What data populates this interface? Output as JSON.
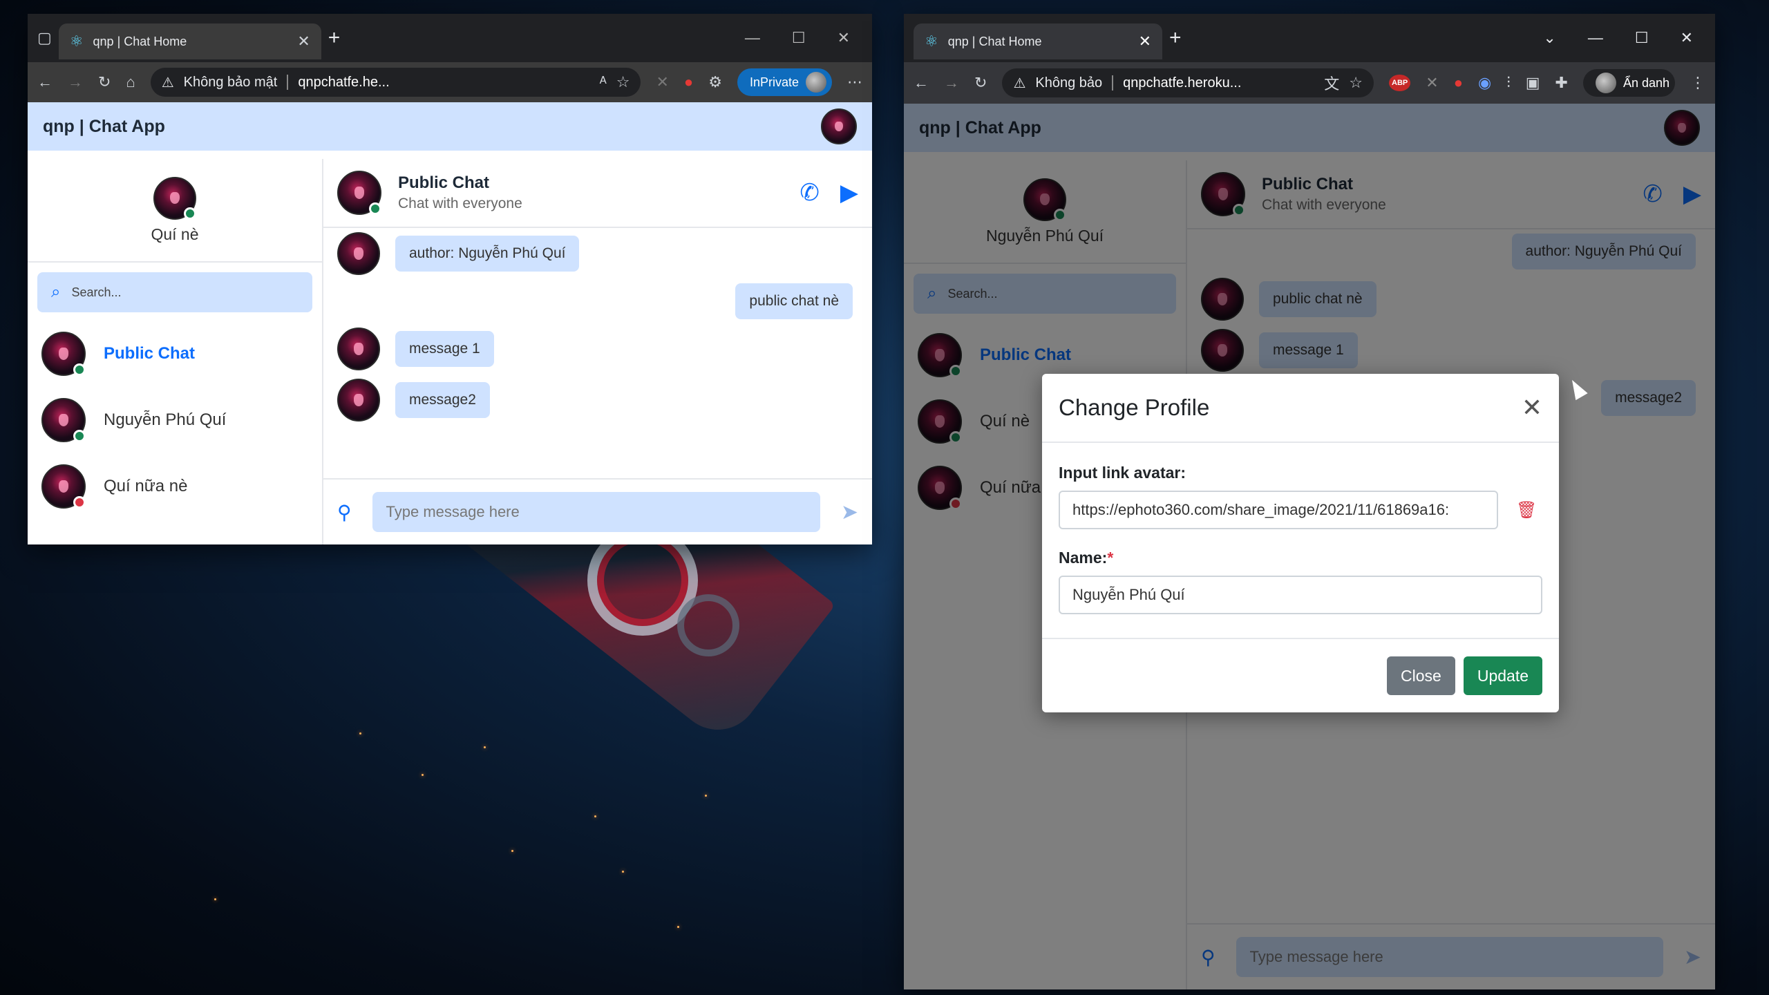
{
  "edge": {
    "tab_title": "qnp | Chat Home",
    "security_label": "Không bảo mật",
    "url": "qnpchatfe.he...",
    "profile_label": "InPrivate"
  },
  "chrome": {
    "tab_title": "qnp | Chat Home",
    "security_label": "Không bảo",
    "url": "qnpchatfe.heroku...",
    "profile_label": "Ẩn danh",
    "ext_abp": "ABP"
  },
  "app_left": {
    "title": "qnp | Chat App",
    "me_name": "Quí nè",
    "search_placeholder": "Search...",
    "contacts": [
      {
        "name": "Public Chat",
        "status": "online",
        "active": true
      },
      {
        "name": "Nguyễn Phú Quí",
        "status": "online",
        "active": false
      },
      {
        "name": "Quí nữa nè",
        "status": "offline",
        "active": false
      }
    ],
    "chat_name": "Public Chat",
    "chat_sub": "Chat with everyone",
    "messages": [
      {
        "text": "author: Nguyễn Phú Quí",
        "mine": false
      },
      {
        "text": "public chat nè",
        "mine": true
      },
      {
        "text": "message 1",
        "mine": false
      },
      {
        "text": "message2",
        "mine": false
      }
    ],
    "input_placeholder": "Type message here"
  },
  "app_right": {
    "title": "qnp | Chat App",
    "me_name": "Nguyễn Phú Quí",
    "search_placeholder": "Search...",
    "contacts": [
      {
        "name": "Public Chat",
        "status": "online",
        "active": true
      },
      {
        "name": "Quí nè",
        "status": "online",
        "active": false
      },
      {
        "name": "Quí nữa",
        "status": "offline",
        "active": false
      }
    ],
    "chat_name": "Public Chat",
    "chat_sub": "Chat with everyone",
    "messages": [
      {
        "text": "author: Nguyễn Phú Quí",
        "mine": true
      },
      {
        "text": "public chat nè",
        "mine": false
      },
      {
        "text": "message 1",
        "mine": false
      },
      {
        "text": "message2",
        "mine": true
      }
    ],
    "input_placeholder": "Type message here"
  },
  "modal": {
    "title": "Change Profile",
    "avatar_label": "Input link avatar:",
    "avatar_value": "https://ephoto360.com/share_image/2021/11/61869a16:",
    "name_label": "Name:",
    "name_required": "*",
    "name_value": "Nguyễn Phú Quí",
    "close_label": "Close",
    "update_label": "Update"
  },
  "colors": {
    "accent": "#0d6efd",
    "header_bg": "#cfe2ff",
    "online": "#198754",
    "offline": "#dc3545"
  }
}
